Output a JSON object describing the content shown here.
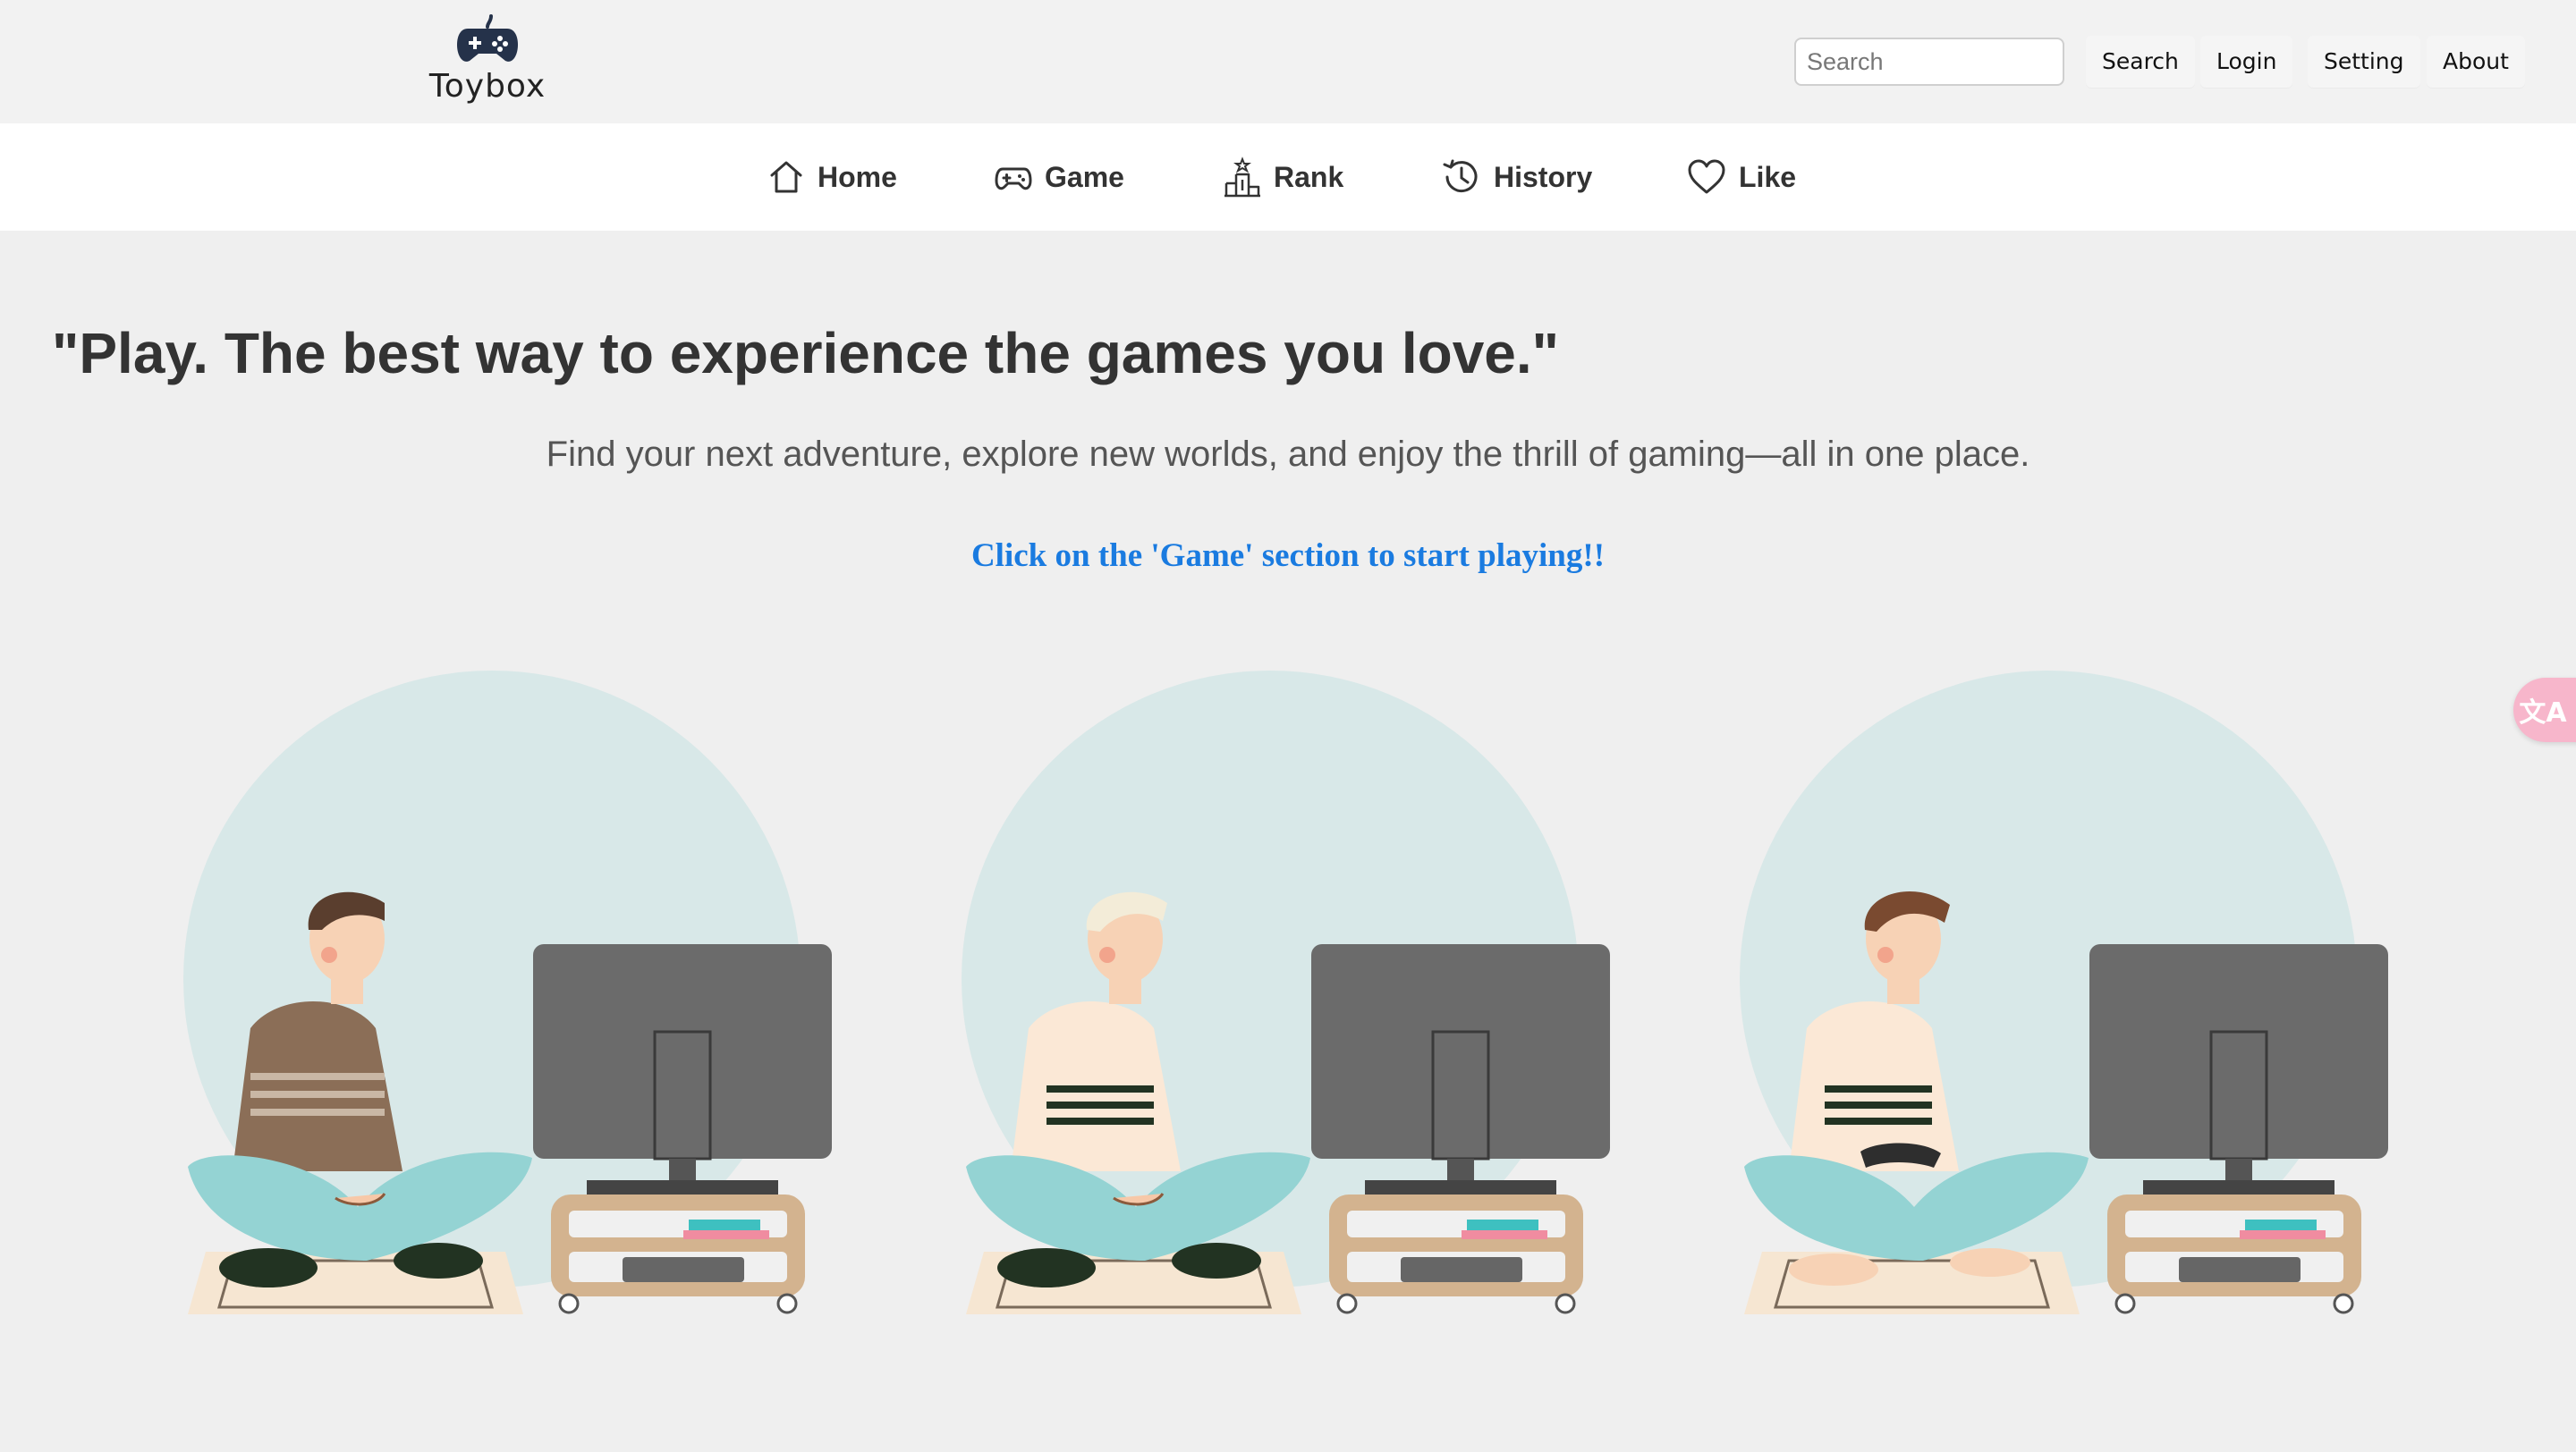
{
  "brand": {
    "name": "Toybox",
    "logo_icon": "gamepad-icon"
  },
  "header": {
    "search_placeholder": "Search",
    "search_value": "",
    "buttons": {
      "search": "Search",
      "login": "Login",
      "setting": "Setting",
      "about": "About"
    }
  },
  "nav": {
    "items": [
      {
        "label": "Home",
        "icon": "home-icon"
      },
      {
        "label": "Game",
        "icon": "gamepad-icon"
      },
      {
        "label": "Rank",
        "icon": "podium-icon"
      },
      {
        "label": "History",
        "icon": "clock-icon"
      },
      {
        "label": "Like",
        "icon": "heart-icon"
      }
    ]
  },
  "hero": {
    "headline": "\"Play. The best way to experience the games you love.\"",
    "subtitle": "Find your next adventure, explore new worlds, and enjoy the thrill of gaming—all in one place.",
    "cta": "Click on the 'Game' section to start playing!!"
  },
  "translate_widget": {
    "label": "文A",
    "icon": "translate-icon"
  },
  "colors": {
    "page_bg": "#efefef",
    "nav_bg": "#ffffff",
    "cta_blue": "#1a7be0",
    "circle": "#d8e8e8",
    "tv": "#6b6b6b",
    "pants": "#94d3d3",
    "stand": "#d3b38f",
    "translate_pink": "#f7b6cb"
  }
}
